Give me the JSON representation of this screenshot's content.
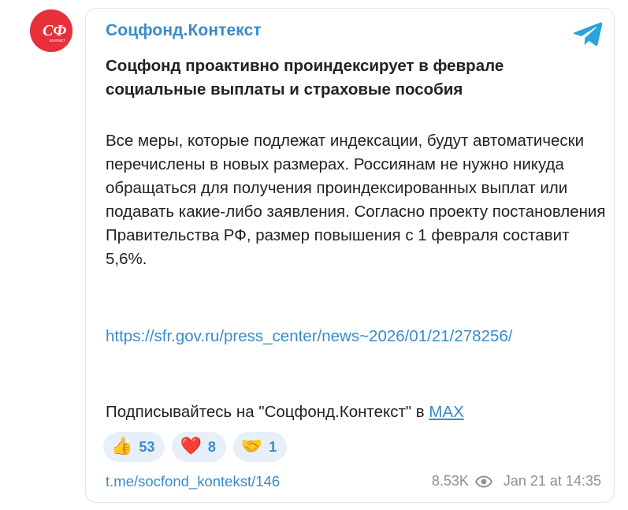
{
  "channel": {
    "name": "Соцфонд.Контекст",
    "avatar_color": "#e8303a",
    "avatar_text": "контекст"
  },
  "post": {
    "title": "Соцфонд проактивно проиндексирует в феврале социальные выплаты и страховые пособия",
    "body": "Все меры, которые подлежат индексации, будут автоматически перечислены в новых размерах. Россиянам не нужно никуда обращаться для получения проиндексированных выплат или подавать какие-либо заявления. Согласно проекту постановления Правительства РФ, размер повышения с 1 февраля составит 5,6%.",
    "link": "https://sfr.gov.ru/press_center/news~2026/01/21/278256/",
    "subscribe_prefix": "Подписывайтесь на \"Соцфонд.Контекст\" в ",
    "subscribe_link": "MAX"
  },
  "reactions": [
    {
      "emoji": "👍",
      "icon": "thumbs-up-icon",
      "count": "53"
    },
    {
      "emoji": "❤️",
      "icon": "heart-icon",
      "count": "8"
    },
    {
      "emoji": "🤝",
      "icon": "handshake-icon",
      "count": "1"
    }
  ],
  "footer": {
    "post_link": "t.me/socfond_kontekst/146",
    "views": "8.53K",
    "views_icon": "eye-icon",
    "date": "Jan 21 at 14:35"
  },
  "colors": {
    "accent": "#3a8bc8",
    "text": "#222222",
    "muted": "#8a9299",
    "reaction_bg": "#e7f0f9",
    "telegram_blue": "#2aa3df"
  }
}
